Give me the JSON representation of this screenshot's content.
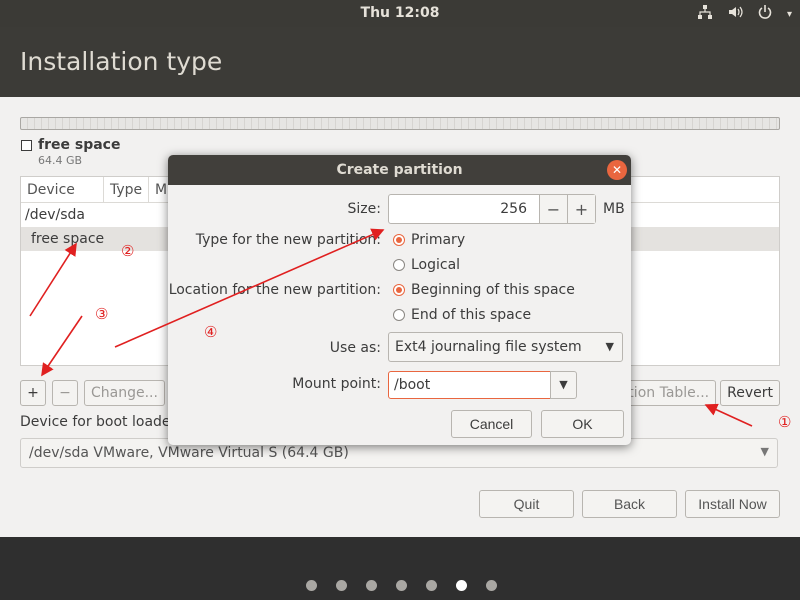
{
  "topbar": {
    "clock": "Thu 12:08",
    "icons": [
      "network-icon",
      "volume-icon",
      "power-icon"
    ],
    "power_arrow": "▾"
  },
  "header": {
    "title": "Installation type"
  },
  "partition": {
    "name": "free space",
    "size": "64.4 GB"
  },
  "table": {
    "columns": [
      "Device",
      "Type",
      "M"
    ],
    "rows": [
      "/dev/sda",
      "free space"
    ]
  },
  "controls": {
    "add": "+",
    "remove": "−",
    "change": "Change...",
    "new_table": "ition Table...",
    "revert": "Revert"
  },
  "boot": {
    "label": "Device for boot loader",
    "value": "/dev/sda VMware, VMware Virtual S (64.4 GB)"
  },
  "nav": {
    "quit": "Quit",
    "back": "Back",
    "install": "Install Now"
  },
  "dialog": {
    "title": "Create partition",
    "size_label": "Size:",
    "size_value": "256",
    "size_unit": "MB",
    "decrement": "−",
    "increment": "+",
    "type_label": "Type for the new partition:",
    "type_options": [
      "Primary",
      "Logical"
    ],
    "type_selected": "Primary",
    "location_label": "Location for the new partition:",
    "location_options": [
      "Beginning of this space",
      "End of this space"
    ],
    "location_selected": "Beginning of this space",
    "use_as_label": "Use as:",
    "use_as_value": "Ext4 journaling file system",
    "mount_label": "Mount point:",
    "mount_value": "/boot",
    "cancel": "Cancel",
    "ok": "OK"
  },
  "annotations": [
    "①",
    "②",
    "③",
    "④"
  ],
  "progress": {
    "total_steps": 7,
    "current_step": 6
  },
  "colors": {
    "accent": "#e9663f",
    "annotation": "#e02020"
  }
}
